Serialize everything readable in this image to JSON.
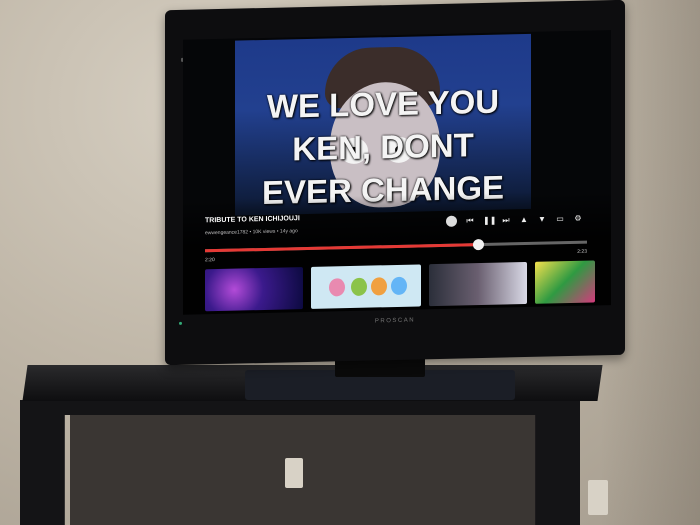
{
  "tv": {
    "brand": "PROSCAN"
  },
  "video": {
    "caption_lines": [
      "WE LOVE YOU",
      "KEN, DONT",
      "EVER CHANGE"
    ],
    "title": "TRIBUTE TO KEN ICHIJOUJI",
    "meta": "ewwengeance1782 • 10K views • 14y ago",
    "time_current": "2:20",
    "time_duration": "2:23",
    "progress": 0.715
  },
  "colors": {
    "progress_red": "#e53935",
    "caption": "#f4f4f4"
  },
  "controls": [
    "avatar",
    "previous-icon",
    "play-pause-icon",
    "next-icon",
    "thumbs-up-icon",
    "thumbs-down-icon",
    "captions-icon",
    "settings-icon"
  ]
}
